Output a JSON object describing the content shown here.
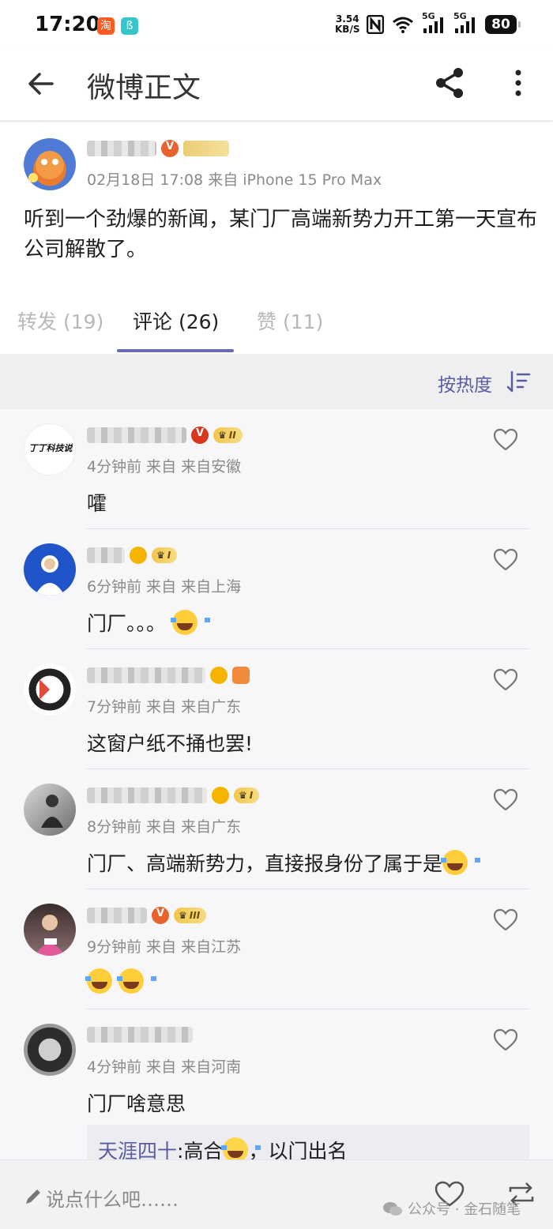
{
  "status_bar": {
    "time": "17:20",
    "app_icon_1": "淘",
    "app_icon_2": "ß",
    "net_speed": "3.54",
    "net_unit": "KB/S",
    "signal_1": "5G",
    "signal_2": "5G",
    "battery": "80"
  },
  "header": {
    "title": "微博正文"
  },
  "post": {
    "meta": "02月18日 17:08  来自 iPhone 15 Pro Max",
    "text": "听到一个劲爆的新闻，某门厂高端新势力开工第一天宣布公司解散了。"
  },
  "tabs": [
    {
      "label": "转发 (19)"
    },
    {
      "label": "评论 (26)"
    },
    {
      "label": "赞 (11)"
    }
  ],
  "sort": {
    "label": "按热度"
  },
  "comments": [
    {
      "meta": "4分钟前 来自 来自安徽",
      "text": "嚯",
      "avatar_text": "丁丁科技说"
    },
    {
      "meta": "6分钟前 来自 来自上海",
      "text": "门厂。。。"
    },
    {
      "meta": "7分钟前 来自 来自广东",
      "text": "这窗户纸不捅也罢!"
    },
    {
      "meta": "8分钟前 来自 来自广东",
      "text": "门厂、高端新势力，直接报身份了属于是"
    },
    {
      "meta": "9分钟前 来自 来自江苏",
      "text": ""
    },
    {
      "meta": "4分钟前 来自 来自河南",
      "text": "门厂啥意思"
    }
  ],
  "reply": {
    "name": "天涯四十",
    "text_a": ":高合",
    "text_b": "，以门出名"
  },
  "bottom_bar": {
    "input_placeholder": "说点什么吧……",
    "watermark": "公众号 · 金石随笔"
  },
  "colors": {
    "accent": "#6a6bb0",
    "sort_text": "#5b5ca0",
    "meta_text": "#8a8a8a"
  }
}
